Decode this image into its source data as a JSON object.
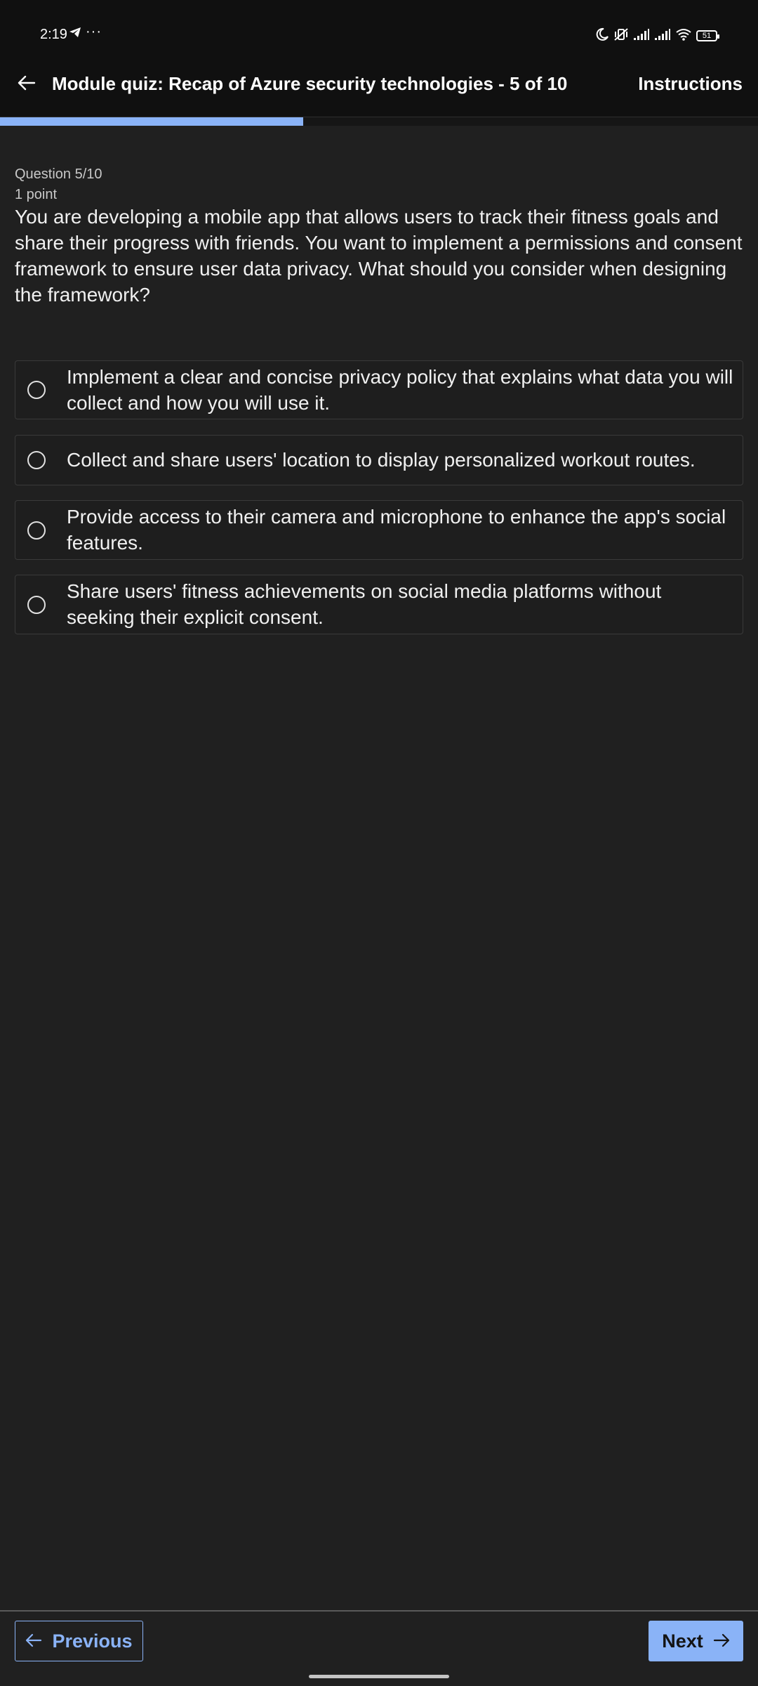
{
  "status_bar": {
    "time": "2:19",
    "more_indicator": "···",
    "battery_level": "51"
  },
  "header": {
    "title": "Module quiz: Recap of Azure security technologies - 5 of 10",
    "instructions_label": "Instructions"
  },
  "progress": {
    "fraction": 0.4
  },
  "question": {
    "number_label": "Question 5/10",
    "points_label": "1 point",
    "text": "You are developing a mobile app that allows users to track their fitness goals and share their progress with friends. You want to implement a permissions and consent framework to ensure user data privacy. What should you consider when designing the framework?"
  },
  "options": [
    {
      "label": "Implement a clear and concise privacy policy that explains what data you will collect and how you will use it.",
      "selected": false
    },
    {
      "label": "Collect and share users' location to display personalized workout routes.",
      "selected": false
    },
    {
      "label": "Provide access to their camera and microphone to enhance the app's social features.",
      "selected": false
    },
    {
      "label": "Share users' fitness achievements on social media platforms without seeking their explicit consent.",
      "selected": false
    }
  ],
  "footer": {
    "previous_label": "Previous",
    "next_label": "Next"
  },
  "colors": {
    "accent": "#8ab3f7",
    "background": "#202020",
    "bar": "#101010"
  }
}
